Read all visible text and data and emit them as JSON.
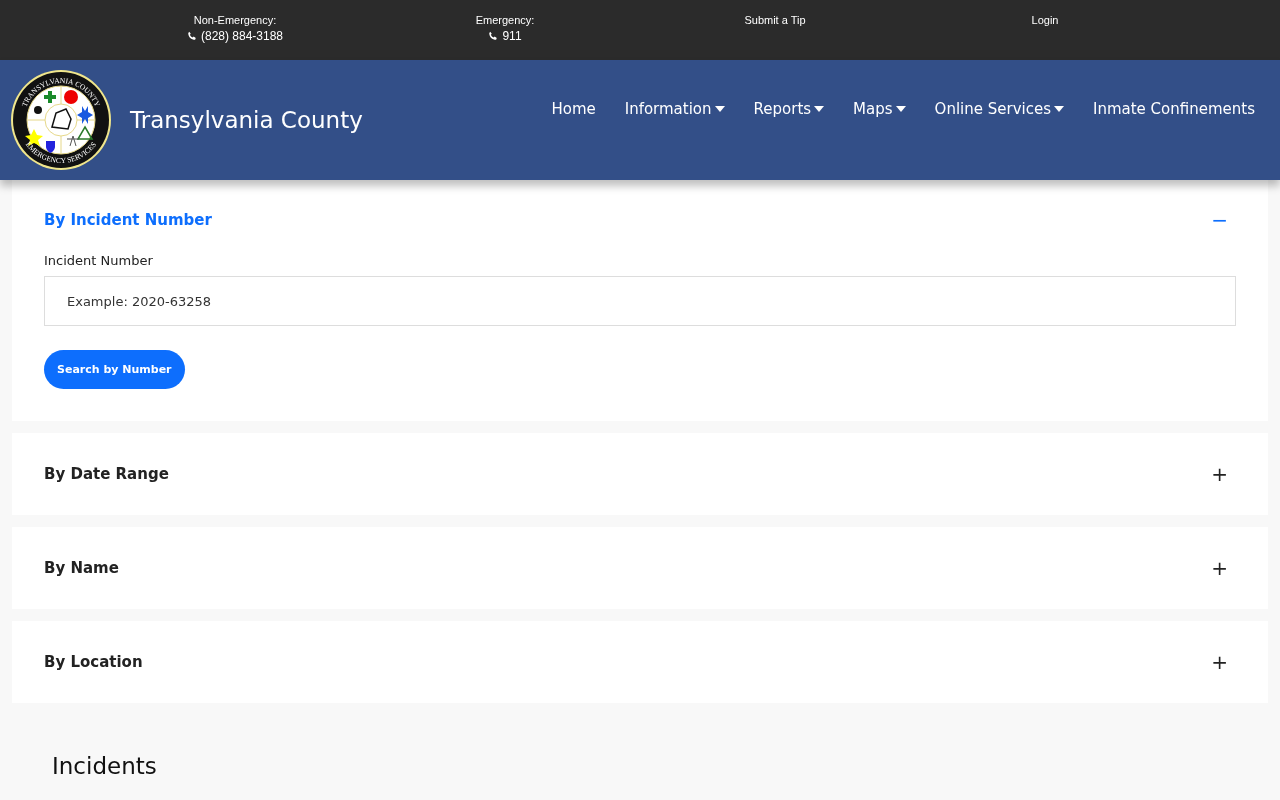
{
  "top_bar": [
    {
      "label": "Non-Emergency:",
      "phone": "(828) 884-3188"
    },
    {
      "label": "Emergency:",
      "phone": "911"
    },
    {
      "label": "Submit a Tip"
    },
    {
      "label": "Login"
    }
  ],
  "logo": {
    "top_text": "TRANSYLVANIA COUNTY",
    "bottom_text": "EMERGENCY SERVICES"
  },
  "site_title": "Transylvania County",
  "nav": [
    {
      "label": "Home",
      "has_menu": false
    },
    {
      "label": "Information",
      "has_menu": true
    },
    {
      "label": "Reports",
      "has_menu": true
    },
    {
      "label": "Maps",
      "has_menu": true
    },
    {
      "label": "Online Services",
      "has_menu": true
    },
    {
      "label": "Inmate Confinements",
      "has_menu": false
    }
  ],
  "sections": [
    {
      "title": "By Incident Number",
      "expanded": true,
      "field_label": "Incident Number",
      "placeholder": "Example: 2020-63258",
      "button": "Search by Number",
      "toggle": "−"
    },
    {
      "title": "By Date Range",
      "expanded": false,
      "toggle": "+"
    },
    {
      "title": "By Name",
      "expanded": false,
      "toggle": "+"
    },
    {
      "title": "By Location",
      "expanded": false,
      "toggle": "+"
    }
  ],
  "heading": "Incidents"
}
